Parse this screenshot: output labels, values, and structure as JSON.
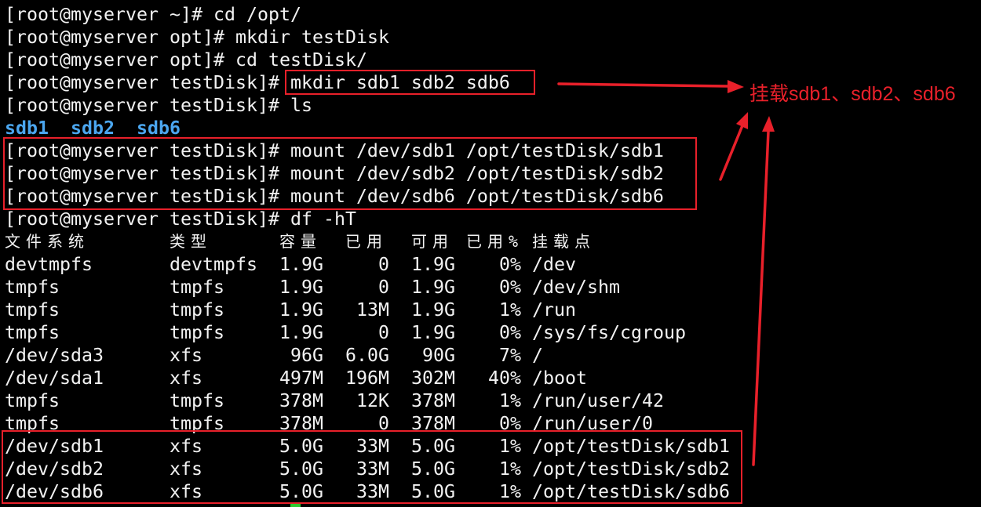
{
  "colors": {
    "background": "#000000",
    "text": "#f2f2f2",
    "ls_directory": "#4ba6ef",
    "annotation": "#e8202a",
    "cursor": "#2ec92e"
  },
  "terminal": {
    "commands": [
      {
        "prompt": "[root@myserver ~]#",
        "command": "cd /opt/"
      },
      {
        "prompt": "[root@myserver opt]#",
        "command": "mkdir testDisk"
      },
      {
        "prompt": "[root@myserver opt]#",
        "command": "cd testDisk/"
      },
      {
        "prompt": "[root@myserver testDisk]#",
        "command": "mkdir sdb1 sdb2 sdb6"
      },
      {
        "prompt": "[root@myserver testDisk]#",
        "command": "ls"
      },
      {
        "prompt": "[root@myserver testDisk]#",
        "command": "mount /dev/sdb1 /opt/testDisk/sdb1"
      },
      {
        "prompt": "[root@myserver testDisk]#",
        "command": "mount /dev/sdb2 /opt/testDisk/sdb2"
      },
      {
        "prompt": "[root@myserver testDisk]#",
        "command": "mount /dev/sdb6 /opt/testDisk/sdb6"
      },
      {
        "prompt": "[root@myserver testDisk]#",
        "command": "df -hT"
      }
    ],
    "ls_output": [
      "sdb1",
      "sdb2",
      "sdb6"
    ],
    "df": {
      "headers": [
        "文件系统",
        "类型",
        "容量",
        "已用",
        "可用",
        "已用%",
        "挂载点"
      ],
      "rows": [
        {
          "filesystem": "devtmpfs",
          "type": "devtmpfs",
          "size": "1.9G",
          "used": "0",
          "avail": "1.9G",
          "use_pct": "0%",
          "mounted_on": "/dev"
        },
        {
          "filesystem": "tmpfs",
          "type": "tmpfs",
          "size": "1.9G",
          "used": "0",
          "avail": "1.9G",
          "use_pct": "0%",
          "mounted_on": "/dev/shm"
        },
        {
          "filesystem": "tmpfs",
          "type": "tmpfs",
          "size": "1.9G",
          "used": "13M",
          "avail": "1.9G",
          "use_pct": "1%",
          "mounted_on": "/run"
        },
        {
          "filesystem": "tmpfs",
          "type": "tmpfs",
          "size": "1.9G",
          "used": "0",
          "avail": "1.9G",
          "use_pct": "0%",
          "mounted_on": "/sys/fs/cgroup"
        },
        {
          "filesystem": "/dev/sda3",
          "type": "xfs",
          "size": "96G",
          "used": "6.0G",
          "avail": "90G",
          "use_pct": "7%",
          "mounted_on": "/"
        },
        {
          "filesystem": "/dev/sda1",
          "type": "xfs",
          "size": "497M",
          "used": "196M",
          "avail": "302M",
          "use_pct": "40%",
          "mounted_on": "/boot"
        },
        {
          "filesystem": "tmpfs",
          "type": "tmpfs",
          "size": "378M",
          "used": "12K",
          "avail": "378M",
          "use_pct": "1%",
          "mounted_on": "/run/user/42"
        },
        {
          "filesystem": "tmpfs",
          "type": "tmpfs",
          "size": "378M",
          "used": "0",
          "avail": "378M",
          "use_pct": "0%",
          "mounted_on": "/run/user/0"
        },
        {
          "filesystem": "/dev/sdb1",
          "type": "xfs",
          "size": "5.0G",
          "used": "33M",
          "avail": "5.0G",
          "use_pct": "1%",
          "mounted_on": "/opt/testDisk/sdb1"
        },
        {
          "filesystem": "/dev/sdb2",
          "type": "xfs",
          "size": "5.0G",
          "used": "33M",
          "avail": "5.0G",
          "use_pct": "1%",
          "mounted_on": "/opt/testDisk/sdb2"
        },
        {
          "filesystem": "/dev/sdb6",
          "type": "xfs",
          "size": "5.0G",
          "used": "33M",
          "avail": "5.0G",
          "use_pct": "1%",
          "mounted_on": "/opt/testDisk/sdb6"
        }
      ]
    }
  },
  "annotation": {
    "label": "挂载sdb1、sdb2、sdb6"
  }
}
